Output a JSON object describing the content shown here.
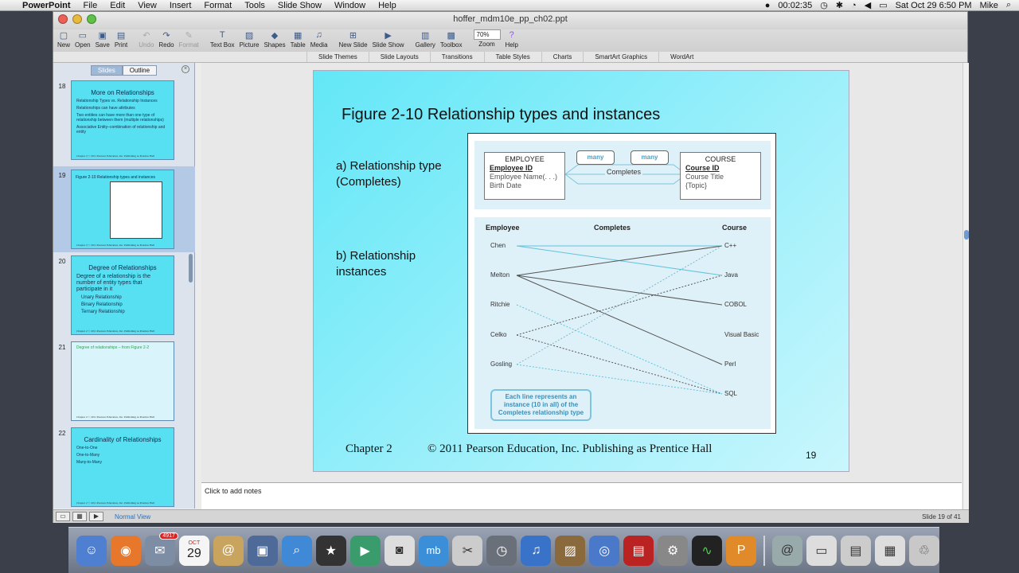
{
  "menubar": {
    "app": "PowerPoint",
    "items": [
      "File",
      "Edit",
      "View",
      "Insert",
      "Format",
      "Tools",
      "Slide Show",
      "Window",
      "Help"
    ],
    "timer": "00:02:35",
    "datetime": "Sat Oct 29  6:50 PM",
    "user": "Mike"
  },
  "window": {
    "title": "hoffer_mdm10e_pp_ch02.ppt"
  },
  "toolbar": {
    "buttons": [
      {
        "label": "New",
        "icon": "new-icon"
      },
      {
        "label": "Open",
        "icon": "open-icon"
      },
      {
        "label": "Save",
        "icon": "save-icon"
      },
      {
        "label": "Print",
        "icon": "print-icon"
      },
      {
        "label": "Undo",
        "icon": "undo-icon",
        "disabled": true
      },
      {
        "label": "Redo",
        "icon": "redo-icon"
      },
      {
        "label": "Format",
        "icon": "format-icon",
        "disabled": true
      },
      {
        "label": "Text Box",
        "icon": "textbox-icon"
      },
      {
        "label": "Picture",
        "icon": "picture-icon"
      },
      {
        "label": "Shapes",
        "icon": "shapes-icon"
      },
      {
        "label": "Table",
        "icon": "table-icon"
      },
      {
        "label": "Media",
        "icon": "media-icon"
      },
      {
        "label": "New Slide",
        "icon": "new-slide-icon"
      },
      {
        "label": "Slide Show",
        "icon": "slideshow-icon"
      },
      {
        "label": "Gallery",
        "icon": "gallery-icon"
      },
      {
        "label": "Toolbox",
        "icon": "toolbox-icon"
      }
    ],
    "zoom_value": "70%",
    "zoom_label": "Zoom",
    "help_label": "Help"
  },
  "ribbon": [
    "Slide Themes",
    "Slide Layouts",
    "Transitions",
    "Table Styles",
    "Charts",
    "SmartArt Graphics",
    "WordArt"
  ],
  "sidebar": {
    "tab_slides": "Slides",
    "tab_outline": "Outline",
    "thumbs": [
      {
        "num": "18",
        "title": "More on Relationships",
        "lines": [
          "Relationship Types vs. Relationship Instances",
          "Relationships can have attributes",
          "Two entities can have more than one type of relationship between them (multiple relationships)",
          "Associative Entity–combination of relationship and entity"
        ],
        "footer": "Chapter 2  © 2011 Pearson Education, Inc.  Publishing as Prentice Hall"
      },
      {
        "num": "19",
        "title": "Figure 2-10 Relationship types and instances",
        "lines": [],
        "footer": "Chapter 2  © 2011 Pearson Education, Inc.  Publishing as Prentice Hall"
      },
      {
        "num": "20",
        "title": "Degree of Relationships",
        "lines": [
          "Degree of a relationship is the number of entity types that participate in it",
          "Unary Relationship",
          "Binary Relationship",
          "Ternary Relationship"
        ],
        "footer": "Chapter 2  © 2011 Pearson Education, Inc.  Publishing as Prentice Hall"
      },
      {
        "num": "21",
        "title": "Degree of relationships – from Figure 2-2",
        "lines": [],
        "footer": "Chapter 2  © 2011 Pearson Education, Inc.  Publishing as Prentice Hall"
      },
      {
        "num": "22",
        "title": "Cardinality of Relationships",
        "lines": [
          "One-to-One",
          "One-to-Many",
          "Many-to-Many"
        ],
        "footer": "Chapter 2  © 2011 Pearson Education, Inc.  Publishing as Prentice Hall"
      }
    ]
  },
  "slide": {
    "title": "Figure 2-10 Relationship types and instances",
    "label_a_line1": "a) Relationship type",
    "label_a_line2": "(Completes)",
    "label_b_line1": "b) Relationship",
    "label_b_line2": "instances",
    "employee_entity": {
      "name": "EMPLOYEE",
      "key": "Employee ID",
      "attrs": [
        "Employee Name(. . .)",
        "Birth Date"
      ]
    },
    "course_entity": {
      "name": "COURSE",
      "key": "Course ID",
      "attrs": [
        "Course Title",
        "{Topic}"
      ]
    },
    "many_left": "many",
    "many_right": "many",
    "relationship": "Completes",
    "col_employee": "Employee",
    "col_completes": "Completes",
    "col_course": "Course",
    "employees": [
      "Chen",
      "Melton",
      "Ritchie",
      "Celko",
      "Gosling"
    ],
    "courses": [
      "C++",
      "Java",
      "COBOL",
      "Visual Basic",
      "Perl",
      "SQL"
    ],
    "note_line1": "Each line represents an",
    "note_line2": "instance (10 in all) of the",
    "note_line3": "Completes relationship type",
    "footer_chapter": "Chapter 2",
    "footer_copyright": "© 2011 Pearson Education, Inc.  Publishing as Prentice Hall",
    "slide_number": "19"
  },
  "notes_placeholder": "Click to add notes",
  "status": {
    "view": "Normal View",
    "slide_of": "Slide 19 of 41"
  },
  "dock": {
    "mail_badge": "4917",
    "calendar_day": "29",
    "calendar_month": "OCT"
  }
}
